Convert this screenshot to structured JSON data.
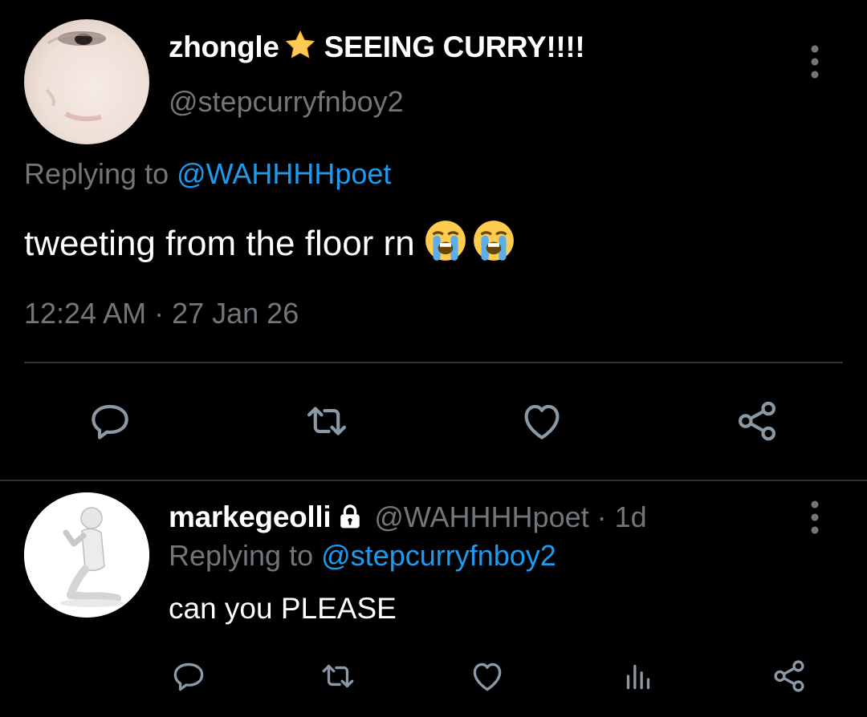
{
  "colors": {
    "background": "#000000",
    "text_primary": "#ffffff",
    "text_secondary": "#71767b",
    "link": "#1d9bf0",
    "divider": "#2f3336",
    "icon": "#8b98a5"
  },
  "main_tweet": {
    "display_name": "zhongle",
    "name_badge_icon": "star-emoji",
    "name_suffix": "SEEING CURRY!!!!",
    "handle": "@stepcurryfnboy2",
    "replying_label": "Replying to",
    "replying_handle": "@WAHHHHpoet",
    "text": "tweeting from the floor rn",
    "text_emojis": [
      "loudly-crying-face-emoji",
      "loudly-crying-face-emoji"
    ],
    "timestamp": "12:24 AM · 27 Jan 26",
    "actions": [
      "reply-icon",
      "retweet-icon",
      "like-icon",
      "share-icon"
    ]
  },
  "reply_tweet": {
    "display_name": "markegeolli",
    "protected_icon": "lock-icon",
    "handle_time": "@WAHHHHpoet · 1d",
    "replying_label": "Replying to",
    "replying_handle": "@stepcurryfnboy2",
    "text": "can you PLEASE",
    "actions": [
      "reply-icon",
      "retweet-icon",
      "like-icon",
      "analytics-icon",
      "share-icon"
    ]
  }
}
